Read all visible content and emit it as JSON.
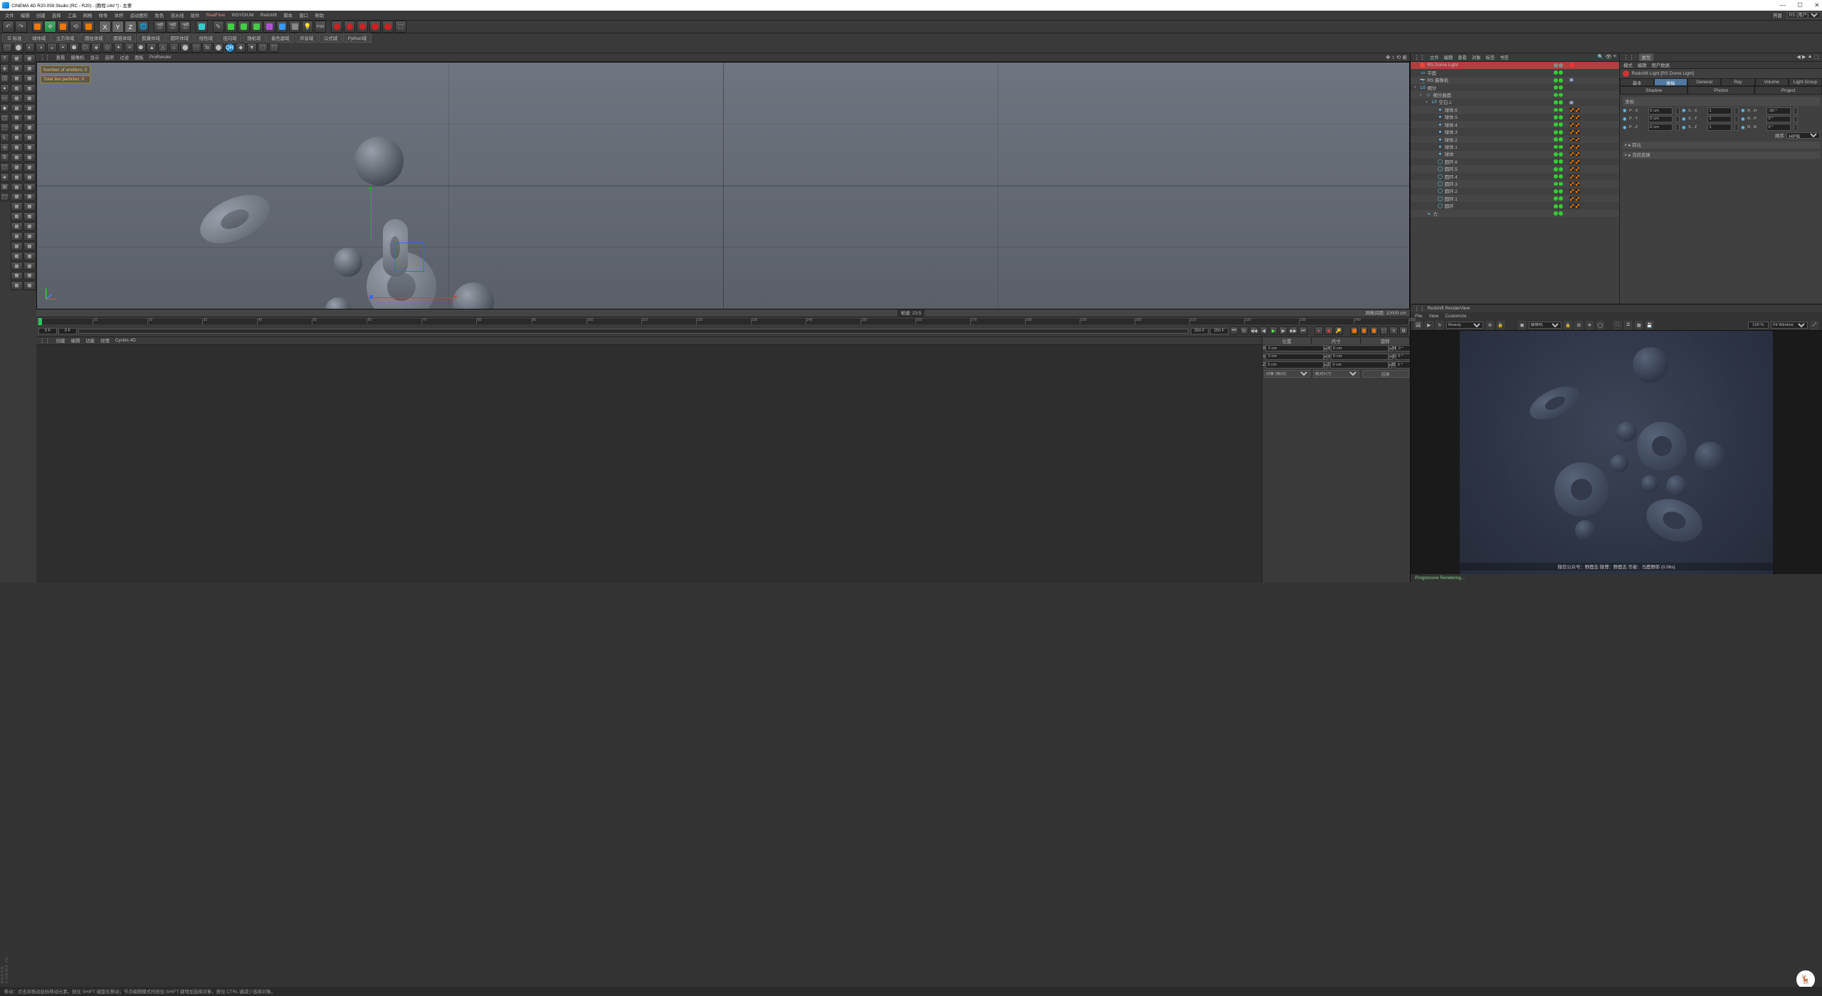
{
  "title": "CINEMA 4D R20.059 Studio (RC - R20) - [教程.c4d *] - 主要",
  "mainmenu": [
    "文件",
    "编辑",
    "创建",
    "选择",
    "工具",
    "网格",
    "样条",
    "体积",
    "运动图形",
    "角色",
    "流水线",
    "插件",
    "RealFlow",
    "INSYDIUM",
    "Redshift",
    "脚本",
    "窗口",
    "帮助"
  ],
  "layout_label": "界面",
  "layout_value": "RS (用户)",
  "toolbar2": [
    "☰  标准",
    "球体域",
    "立方体域",
    "圆柱体域",
    "圆锥体域",
    "胶囊体域",
    "圆环体域",
    "线性域",
    "径向域",
    "随机域",
    "着色器域",
    "声音域",
    "公式域",
    "Python域"
  ],
  "viewport_menu": [
    "查看",
    "摄像机",
    "显示",
    "选项",
    "过滤",
    "面板",
    "ProRender"
  ],
  "hud": {
    "emitters": "Number of emitters: 0",
    "particles": "Total live particles: 0"
  },
  "vp_footer": {
    "mid": "帧速: 23.5",
    "right": "网格间距: 10000 cm"
  },
  "timeline_ticks": [
    "0",
    "10",
    "20",
    "30",
    "40",
    "50",
    "60",
    "70",
    "80",
    "90",
    "100",
    "110",
    "120",
    "130",
    "140",
    "150",
    "160",
    "170",
    "180",
    "190",
    "200",
    "210",
    "220",
    "230",
    "240",
    "250"
  ],
  "transport": {
    "start": "0 F",
    "cur": "0 F",
    "range_end": "250 F",
    "end": "250 F"
  },
  "mat_menu": [
    "创建",
    "编辑",
    "功能",
    "纹理",
    "Cycles 4D"
  ],
  "coord": {
    "headers": [
      "位置",
      "尺寸",
      "旋转"
    ],
    "rows": [
      {
        "a": "X",
        "av": "0 cm",
        "b": "X",
        "bv": "0 cm",
        "c": "H",
        "cv": "0 °"
      },
      {
        "a": "Y",
        "av": "0 cm",
        "b": "Y",
        "bv": "0 cm",
        "c": "P",
        "cv": "0 °"
      },
      {
        "a": "Z",
        "av": "0 cm",
        "b": "Z",
        "bv": "0 cm",
        "c": "B",
        "cv": "0 °"
      }
    ],
    "mode1": "对象 (相对)",
    "mode2": "绝对尺寸",
    "apply": "应用"
  },
  "objman_menu": [
    "文件",
    "编辑",
    "查看",
    "对象",
    "标签",
    "书签"
  ],
  "objects": [
    {
      "lv": 0,
      "exp": "",
      "icon": "🔴",
      "name": "RS Dome Light",
      "sel": true,
      "tags": [
        "dot-gr",
        "dot-gr"
      ],
      "extra": [
        "rs"
      ]
    },
    {
      "lv": 0,
      "exp": "",
      "icon": "▭",
      "name": "平面",
      "tags": [
        "dot-g",
        "dot-g"
      ],
      "extra": []
    },
    {
      "lv": 0,
      "exp": "",
      "icon": "📷",
      "name": "RS 摄像机",
      "tags": [
        "dot-g",
        "dot-g"
      ],
      "extra": [
        "view"
      ]
    },
    {
      "lv": 0,
      "exp": "▾",
      "icon": "L0",
      "name": "细分",
      "tags": [
        "dot-g",
        "dot-g"
      ],
      "extra": []
    },
    {
      "lv": 1,
      "exp": "▾",
      "icon": "◇",
      "name": "细分曲面",
      "tags": [
        "dot-g",
        "dot-g"
      ],
      "extra": []
    },
    {
      "lv": 2,
      "exp": "▾",
      "icon": "L0",
      "name": "空白.1",
      "tags": [
        "dot-g",
        "dot-g"
      ],
      "extra": [
        "sim"
      ]
    },
    {
      "lv": 3,
      "exp": "",
      "icon": "●",
      "name": "球体.6",
      "tags": [
        "dot-g",
        "dot-g"
      ],
      "extra": [
        "or",
        "or"
      ]
    },
    {
      "lv": 3,
      "exp": "",
      "icon": "●",
      "name": "球体.5",
      "tags": [
        "dot-g",
        "dot-g"
      ],
      "extra": [
        "or",
        "or"
      ]
    },
    {
      "lv": 3,
      "exp": "",
      "icon": "●",
      "name": "球体.4",
      "tags": [
        "dot-g",
        "dot-g"
      ],
      "extra": [
        "or",
        "or"
      ]
    },
    {
      "lv": 3,
      "exp": "",
      "icon": "●",
      "name": "球体.3",
      "tags": [
        "dot-g",
        "dot-g"
      ],
      "extra": [
        "or",
        "or"
      ]
    },
    {
      "lv": 3,
      "exp": "",
      "icon": "●",
      "name": "球体.2",
      "tags": [
        "dot-g",
        "dot-g"
      ],
      "extra": [
        "or",
        "or"
      ]
    },
    {
      "lv": 3,
      "exp": "",
      "icon": "●",
      "name": "球体.1",
      "tags": [
        "dot-g",
        "dot-g"
      ],
      "extra": [
        "or",
        "or"
      ]
    },
    {
      "lv": 3,
      "exp": "",
      "icon": "●",
      "name": "球体",
      "tags": [
        "dot-g",
        "dot-g"
      ],
      "extra": [
        "or",
        "or"
      ]
    },
    {
      "lv": 3,
      "exp": "",
      "icon": "◯",
      "name": "圆环.6",
      "tags": [
        "dot-g",
        "dot-g"
      ],
      "extra": [
        "or",
        "or"
      ]
    },
    {
      "lv": 3,
      "exp": "",
      "icon": "◯",
      "name": "圆环.5",
      "tags": [
        "dot-g",
        "dot-g"
      ],
      "extra": [
        "or",
        "or"
      ]
    },
    {
      "lv": 3,
      "exp": "",
      "icon": "◯",
      "name": "圆环.4",
      "tags": [
        "dot-g",
        "dot-g"
      ],
      "extra": [
        "or",
        "or"
      ]
    },
    {
      "lv": 3,
      "exp": "",
      "icon": "◯",
      "name": "圆环.3",
      "tags": [
        "dot-g",
        "dot-g"
      ],
      "extra": [
        "or",
        "or"
      ]
    },
    {
      "lv": 3,
      "exp": "",
      "icon": "◯",
      "name": "圆环.2",
      "tags": [
        "dot-g",
        "dot-g"
      ],
      "extra": [
        "or",
        "or"
      ]
    },
    {
      "lv": 3,
      "exp": "",
      "icon": "◯",
      "name": "圆环.1",
      "tags": [
        "dot-g",
        "dot-g"
      ],
      "extra": [
        "or",
        "or"
      ]
    },
    {
      "lv": 3,
      "exp": "",
      "icon": "◯",
      "name": "圆环",
      "tags": [
        "dot-g",
        "dot-g"
      ],
      "extra": [
        "or",
        "or"
      ]
    },
    {
      "lv": 1,
      "exp": "",
      "icon": "↘",
      "name": "力",
      "tags": [
        "dot-g",
        "dot-g"
      ],
      "extra": []
    }
  ],
  "attr_menu": [
    "模式",
    "编辑",
    "用户数据"
  ],
  "attr_title": "Redshift Light [RS Dome Light]",
  "attr_tabs_row1": [
    "基本",
    "坐标",
    "General",
    "Ray",
    "Volume",
    "Light Group"
  ],
  "attr_tabs_row2": [
    "Shadow",
    "Photon",
    "Project"
  ],
  "attr_active_tab": 1,
  "attr_section": "坐标",
  "attr_fields": [
    [
      {
        "l": "P . X",
        "v": "0 cm"
      },
      {
        "l": "S . X",
        "v": "1"
      },
      {
        "l": "R . H",
        "v": "-30 °"
      }
    ],
    [
      {
        "l": "P . Y",
        "v": "0 cm"
      },
      {
        "l": "S . Y",
        "v": "1"
      },
      {
        "l": "R . P",
        "v": "0 °"
      }
    ],
    [
      {
        "l": "P . Z",
        "v": "0 cm"
      },
      {
        "l": "S . Z",
        "v": "1"
      },
      {
        "l": "R . B",
        "v": "0 °"
      }
    ]
  ],
  "attr_order_label": "顺序",
  "attr_order_value": "HPB",
  "attr_subsections": [
    "▸ 四元",
    "▸ 冻结变换"
  ],
  "rv_title": "Redshift RenderView",
  "rv_menu": [
    "File",
    "View",
    "Customize"
  ],
  "rv_aov": "Beauty",
  "rv_cam": "摄像机",
  "rv_zoom": "100 %",
  "rv_fit": "Fit Window",
  "rv_watermark": "微信公众号：野鹿志   微博：野鹿志   作者：马鹿野郎  (0.06s)",
  "rv_status": "Progressive Rendering...",
  "statusbar": "移动：点击并拖动鼠标移动元素。按住 SHIFT 键盘化移动；节点编辑模式时按住 SHIFT 键增加选择对象，按住 CTRL 键减少选择对象。"
}
